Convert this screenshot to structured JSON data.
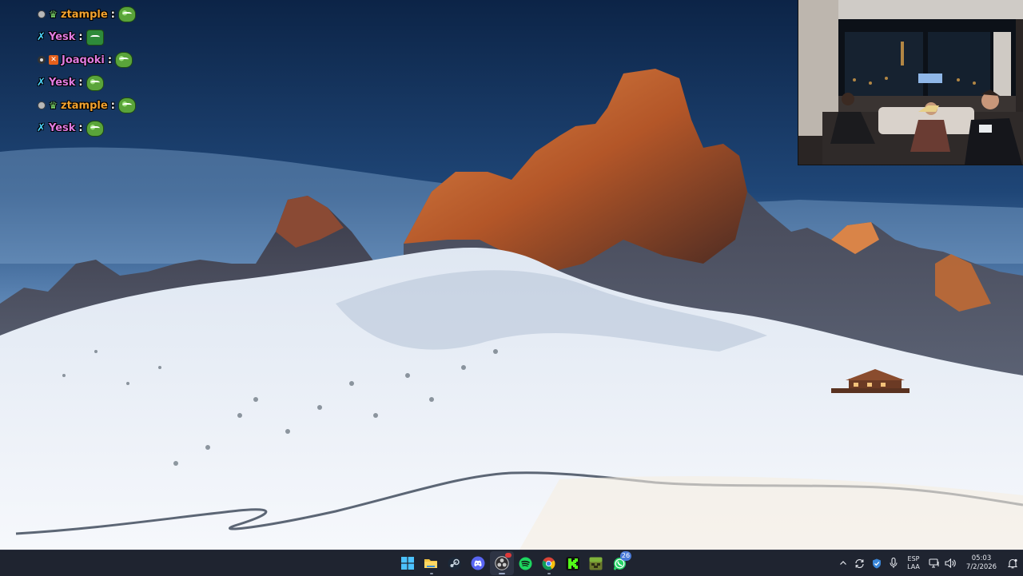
{
  "chat": {
    "messages": [
      {
        "user": "ztample",
        "user_color": "#f2a22f",
        "badges": [
          "dot-badge-icon",
          "subscriber-badge-icon"
        ],
        "emote": "pepe-frog-emote-icon"
      },
      {
        "user": "Yesk",
        "user_color": "#d874d6",
        "badges": [
          "sword-badge-icon"
        ],
        "emote": "pepe-frog-hat-emote-icon"
      },
      {
        "user": "Joaqoki",
        "user_color": "#d874d6",
        "badges": [
          "ring-badge-icon",
          "box-badge-icon"
        ],
        "emote": "pepe-frog-emote-icon"
      },
      {
        "user": "Yesk",
        "user_color": "#d874d6",
        "badges": [
          "sword-badge-icon"
        ],
        "emote": "pepe-frog-emote-icon"
      },
      {
        "user": "ztample",
        "user_color": "#f2a22f",
        "badges": [
          "dot-badge-icon",
          "subscriber-badge-icon"
        ],
        "emote": "pepe-frog-emote-icon"
      },
      {
        "user": "Yesk",
        "user_color": "#d874d6",
        "badges": [
          "sword-badge-icon"
        ],
        "emote": "pepe-frog-emote-icon"
      }
    ],
    "separator": ":"
  },
  "taskbar": {
    "apps": [
      {
        "name": "start-button",
        "icon": "windows-icon"
      },
      {
        "name": "file-explorer",
        "icon": "folder-icon",
        "state": "running"
      },
      {
        "name": "steam",
        "icon": "steam-icon"
      },
      {
        "name": "discord",
        "icon": "discord-icon"
      },
      {
        "name": "obs-studio",
        "icon": "obs-icon",
        "state": "active"
      },
      {
        "name": "spotify",
        "icon": "spotify-icon"
      },
      {
        "name": "chrome",
        "icon": "chrome-icon",
        "state": "running"
      },
      {
        "name": "kick",
        "icon": "kick-icon"
      },
      {
        "name": "minecraft",
        "icon": "minecraft-icon"
      },
      {
        "name": "whatsapp",
        "icon": "whatsapp-icon",
        "badge": "26"
      }
    ],
    "tray": {
      "language_line1": "ESP",
      "language_line2": "LAA",
      "time": "05:03",
      "date": "7/2/2026"
    }
  },
  "colors": {
    "taskbar_bg": "#1f2430",
    "sky_top": "#0d2a4f",
    "snow": "#f3f6fb",
    "rock_lit": "#c9672e"
  }
}
